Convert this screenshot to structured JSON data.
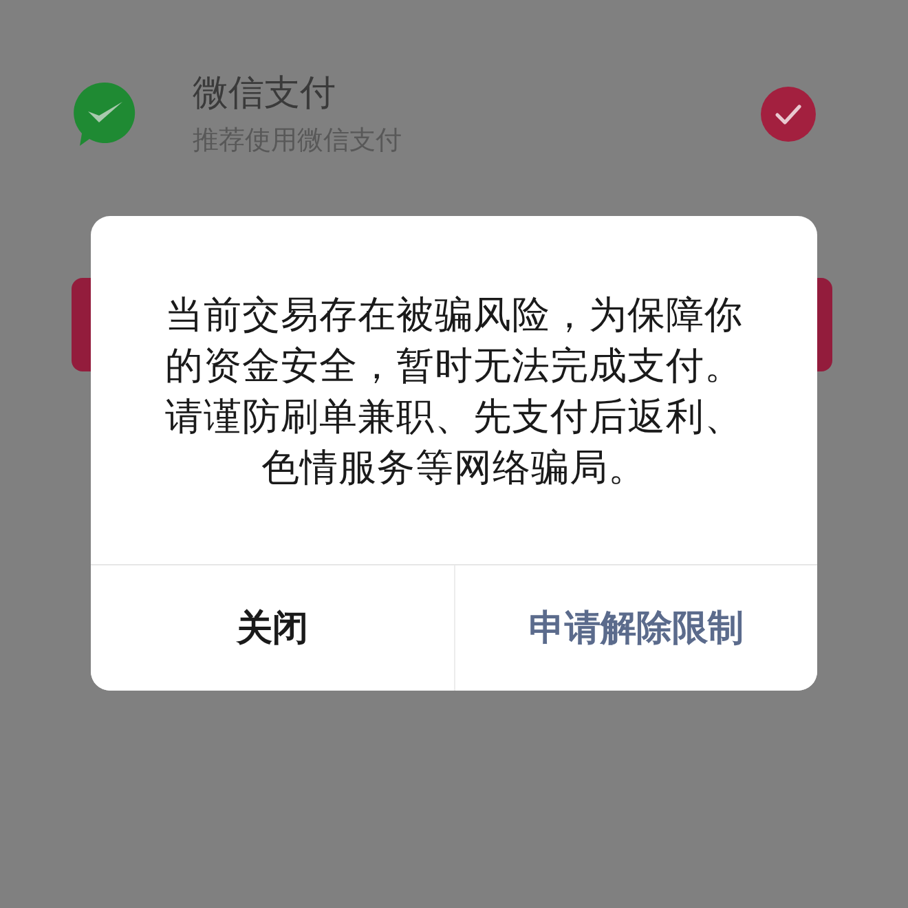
{
  "payment_option": {
    "title": "微信支付",
    "subtitle": "推荐使用微信支付",
    "selected": true
  },
  "dialog": {
    "message": "当前交易存在被骗风险，为保障你的资金安全，暂时无法完成支付。请谨防刷单兼职、先支付后返利、色情服务等网络骗局。",
    "buttons": [
      {
        "label": "关闭",
        "kind": "secondary"
      },
      {
        "label": "申请解除限制",
        "kind": "primary"
      }
    ]
  }
}
